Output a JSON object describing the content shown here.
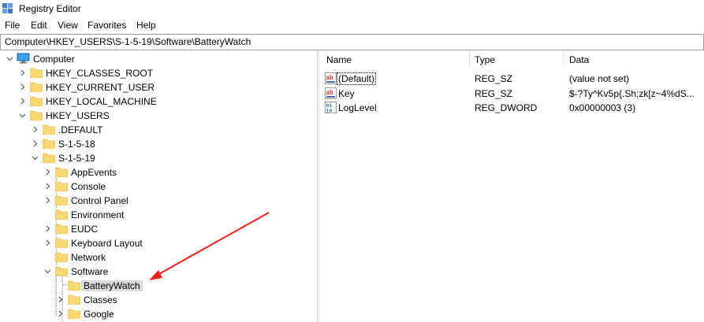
{
  "window": {
    "title": "Registry Editor"
  },
  "menu": [
    "File",
    "Edit",
    "View",
    "Favorites",
    "Help"
  ],
  "address": "Computer\\HKEY_USERS\\S-1-5-19\\Software\\BatteryWatch",
  "tree": {
    "root": "Computer",
    "hives": [
      "HKEY_CLASSES_ROOT",
      "HKEY_CURRENT_USER",
      "HKEY_LOCAL_MACHINE",
      "HKEY_USERS"
    ],
    "users": [
      ".DEFAULT",
      "S-1-5-18",
      "S-1-5-19"
    ],
    "sid_children": [
      "AppEvents",
      "Console",
      "Control Panel",
      "Environment",
      "EUDC",
      "Keyboard Layout",
      "Network",
      "Software"
    ],
    "software_children": [
      "BatteryWatch",
      "Classes",
      "Google"
    ]
  },
  "columns": {
    "name": "Name",
    "type": "Type",
    "data": "Data"
  },
  "values": [
    {
      "name": "(Default)",
      "type": "REG_SZ",
      "data": "(value not set)",
      "icon": "string-value-icon"
    },
    {
      "name": "Key",
      "type": "REG_SZ",
      "data": "$-?Ty^Kv5p{.Sh;zk[z~4%dS...",
      "icon": "string-value-icon"
    },
    {
      "name": "LogLevel",
      "type": "REG_DWORD",
      "data": "0x00000003 (3)",
      "icon": "binary-value-icon"
    }
  ],
  "colors": {
    "folder": "#f8d775",
    "selection": "#d9d9d9",
    "annotation_arrow": "#e8221b"
  }
}
